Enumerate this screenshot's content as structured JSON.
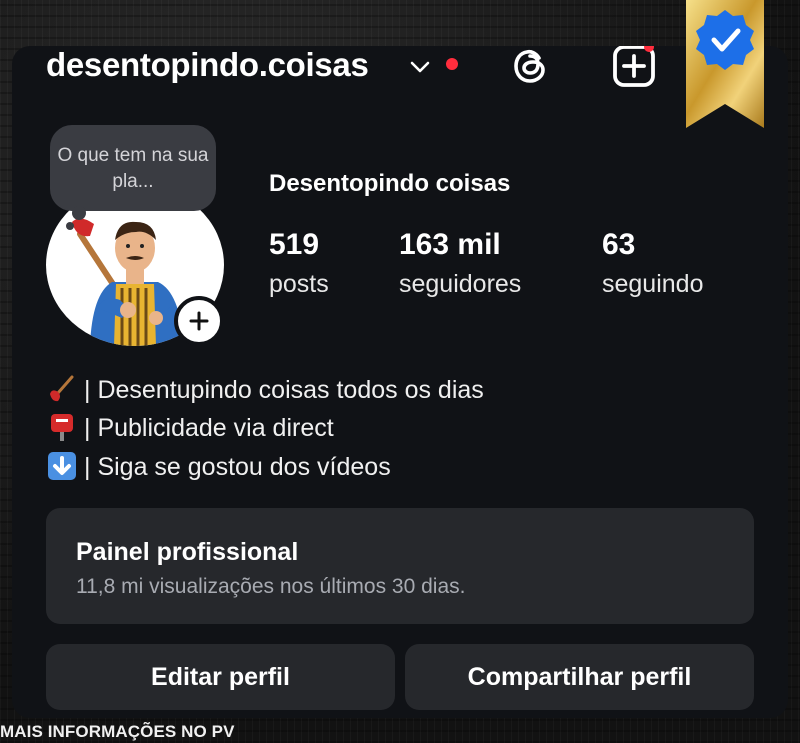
{
  "header": {
    "username": "desentopindo.coisas"
  },
  "profile": {
    "note": "O que tem na sua pla...",
    "full_name": "Desentopindo coisas",
    "stats": [
      {
        "value": "519",
        "label": "posts"
      },
      {
        "value": "163 mil",
        "label": "seguidores"
      },
      {
        "value": "63",
        "label": "seguindo"
      }
    ]
  },
  "bio": [
    {
      "icon": "plunger-icon",
      "text": "| Desentupindo coisas todos os dias"
    },
    {
      "icon": "postbox-icon",
      "text": "| Publicidade via direct"
    },
    {
      "icon": "down-arrow-icon",
      "text": "| Siga se gostou dos vídeos"
    }
  ],
  "professional_panel": {
    "title": "Painel profissional",
    "subtitle": "11,8 mi visualizações nos últimos 30 dias."
  },
  "actions": {
    "edit_label": "Editar perfil",
    "share_label": "Compartilhar perfil"
  },
  "footer": {
    "text": "MAIS INFORMAÇÕES NO PV"
  },
  "colors": {
    "background": "#101216",
    "button": "#26282c",
    "notification_red": "#ff2d3d",
    "verified_blue": "#1d6fe8",
    "ribbon_gold": "#d9b44a"
  }
}
